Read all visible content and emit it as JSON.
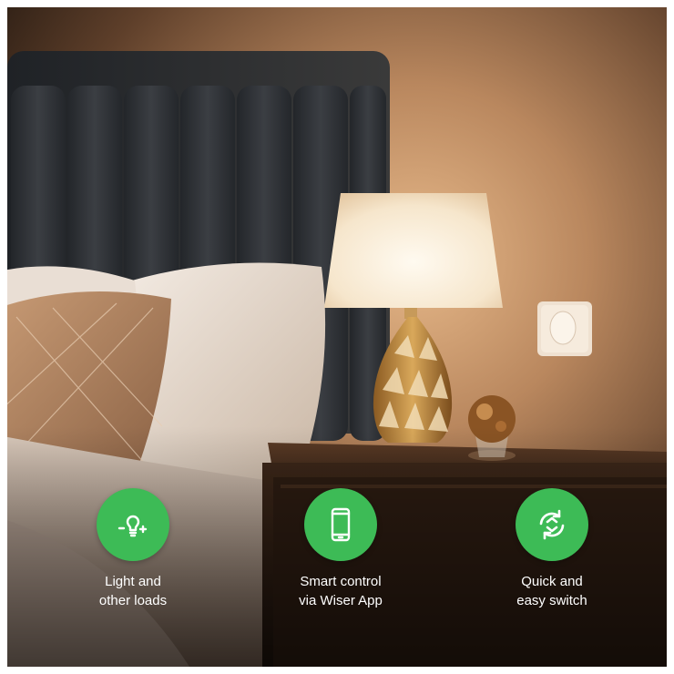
{
  "colors": {
    "badge_green": "#3dbb56",
    "icon_white": "#ffffff",
    "caption_text": "#ffffff"
  },
  "features": [
    {
      "icon": "bulb-dimmer-icon",
      "line1": "Light and",
      "line2": "other loads"
    },
    {
      "icon": "smartphone-icon",
      "line1": "Smart control",
      "line2": "via Wiser App"
    },
    {
      "icon": "swap-arrows-icon",
      "line1": "Quick and",
      "line2": "easy switch"
    }
  ]
}
